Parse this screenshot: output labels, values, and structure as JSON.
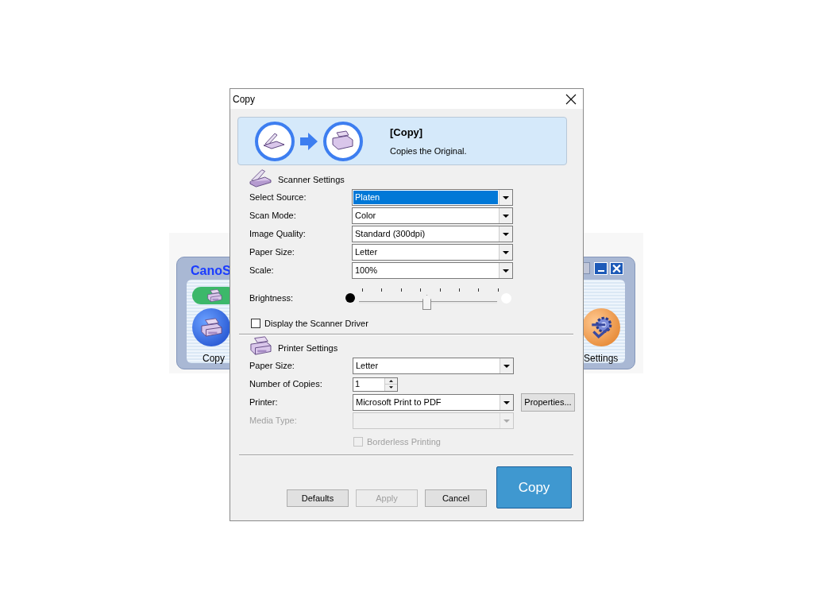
{
  "background_window": {
    "title": "CanoS",
    "buttons": [
      {
        "label": "Copy",
        "kind": "copy"
      },
      {
        "label": "Settings",
        "kind": "settings"
      }
    ]
  },
  "dialog": {
    "title": "Copy",
    "banner": {
      "heading": "[Copy]",
      "description": "Copies the Original."
    },
    "scanner_settings": {
      "heading": "Scanner Settings",
      "fields": [
        {
          "label": "Select Source:",
          "value": "Platen",
          "focused": true
        },
        {
          "label": "Scan Mode:",
          "value": "Color",
          "focused": false
        },
        {
          "label": "Image Quality:",
          "value": "Standard (300dpi)",
          "focused": false
        },
        {
          "label": "Paper Size:",
          "value": "Letter",
          "focused": false
        },
        {
          "label": "Scale:",
          "value": "100%",
          "focused": false
        }
      ],
      "brightness": {
        "label": "Brightness:",
        "level": 0.5
      },
      "driver_checkbox": {
        "label": "Display the Scanner Driver",
        "checked": false
      }
    },
    "printer_settings": {
      "heading": "Printer Settings",
      "fields": [
        {
          "label": "Paper Size:",
          "kind": "dropdown",
          "value": "Letter",
          "disabled": false
        },
        {
          "label": "Number of Copies:",
          "kind": "spin",
          "value": "1",
          "disabled": false
        },
        {
          "label": "Printer:",
          "kind": "dropdown",
          "value": "Microsoft Print to PDF",
          "disabled": false,
          "button": "Properties..."
        },
        {
          "label": "Media Type:",
          "kind": "dropdown",
          "disabled": true
        }
      ],
      "borderless_checkbox": {
        "label": "Borderless Printing",
        "checked": false,
        "disabled": true
      }
    },
    "buttons": [
      {
        "label": "Defaults",
        "disabled": false
      },
      {
        "label": "Apply",
        "disabled": true
      },
      {
        "label": "Cancel",
        "disabled": false
      }
    ],
    "primary_button": "Copy"
  }
}
